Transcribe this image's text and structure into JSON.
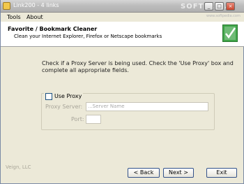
{
  "window": {
    "title": "Link200 - 4 links"
  },
  "watermark": {
    "text": "SOFTPEDIA",
    "url": "www.softpedia.com"
  },
  "window_controls": {
    "minimize": "_",
    "maximize": "□",
    "close": "×"
  },
  "menu": [
    {
      "label": "Tools"
    },
    {
      "label": "About"
    }
  ],
  "header": {
    "title": "Favorite / Bookmark Cleaner",
    "subtitle": "Clean your Internet Explorer, Firefox or Netscape bookmarks",
    "icon": "checkmark-document-icon"
  },
  "instructions": "Check if a Proxy Server is being used.  Check the 'Use Proxy' box and complete all appropriate fields.",
  "proxy": {
    "checkbox_label": "Use Proxy",
    "checked": false,
    "server_label": "Proxy Server:",
    "server_placeholder": "...Server Name",
    "port_label": "Port:",
    "port_value": ""
  },
  "footer": {
    "company": "Veign, LLC"
  },
  "buttons": {
    "back": "< Back",
    "next": "Next >",
    "exit": "Exit"
  },
  "colors": {
    "title_bar": "#bdbdbd",
    "dialog_bg": "#ece9d8",
    "disabled_text": "#a8a59a"
  }
}
